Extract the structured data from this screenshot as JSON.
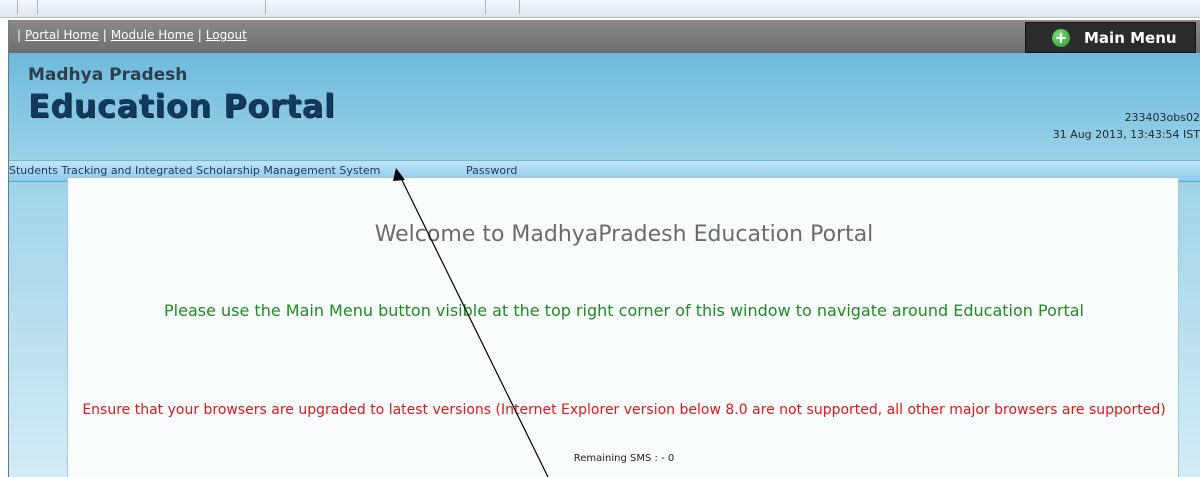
{
  "top_nav": {
    "links": [
      "Portal Home",
      "Module Home",
      "Logout"
    ],
    "main_menu_label": "Main Menu"
  },
  "header": {
    "state": "Madhya Pradesh",
    "portal_title": "Education Portal",
    "user_id": "233403obs02",
    "datetime": "31 Aug 2013, 13:43:54 IST"
  },
  "menu_bar": {
    "items": [
      "Students Tracking and Integrated Scholarship Management System",
      "Password"
    ]
  },
  "content": {
    "welcome": "Welcome to MadhyaPradesh Education Portal",
    "info": "Please use the Main Menu button visible at the top right corner of this window to navigate around Education Portal",
    "warning": "Ensure that your browsers are upgraded to latest versions (Internet Explorer version below 8.0 are not supported, all other major browsers are supported)",
    "sms": "Remaining SMS : - 0"
  },
  "colors": {
    "info_text": "#1e8c1e",
    "warning_text": "#e01818",
    "title_text": "#14395f"
  }
}
